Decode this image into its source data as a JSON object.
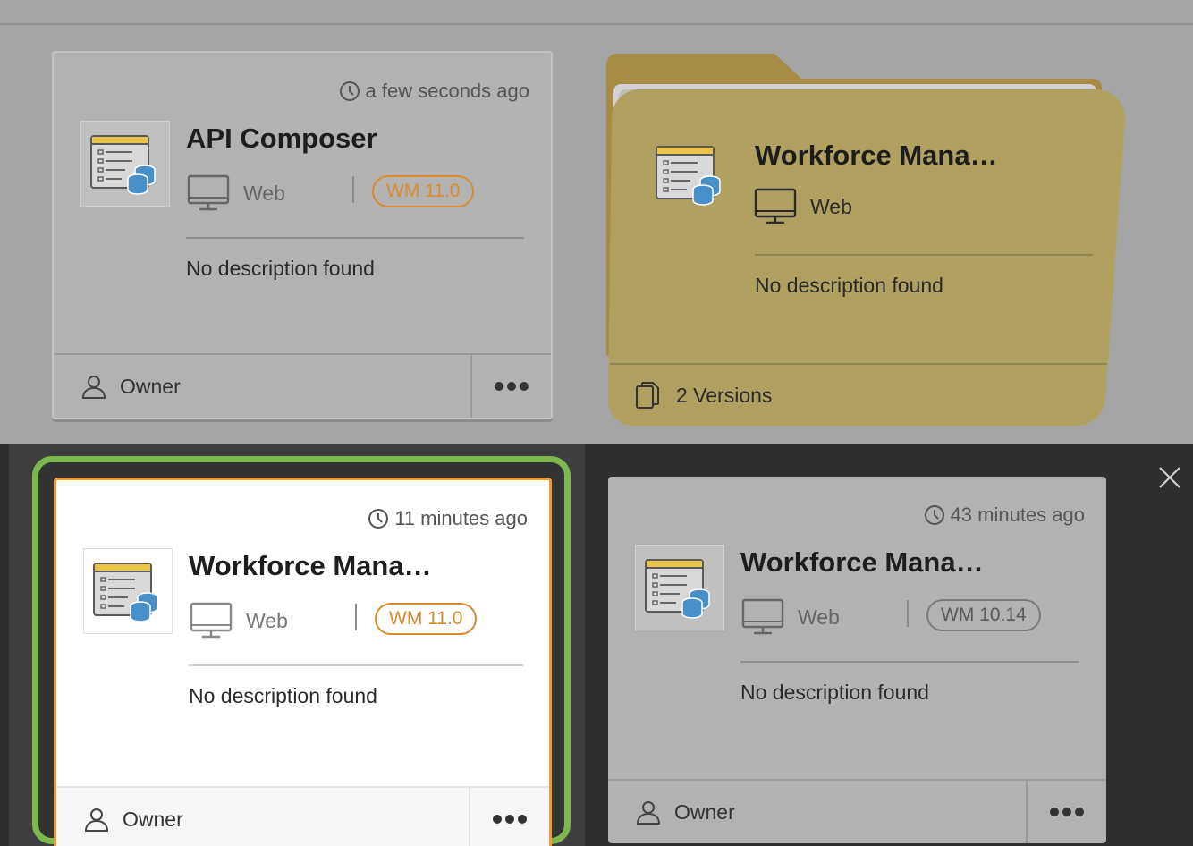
{
  "colors": {
    "accent_orange": "#f09a35",
    "selection_green": "#7fb74f",
    "folder_gold": "#b0a161"
  },
  "cards": [
    {
      "time": "a few seconds ago",
      "title": "API Composer",
      "platform": "Web",
      "version": "WM 11.0",
      "description": "No description found",
      "owner": "Owner",
      "icon": "clock-icon"
    },
    {
      "time": "11 minutes ago",
      "title": "Workforce Mana…",
      "platform": "Web",
      "version": "WM 11.0",
      "description": "No description found",
      "owner": "Owner",
      "selected": true
    },
    {
      "time": "43 minutes ago",
      "title": "Workforce Mana…",
      "platform": "Web",
      "version": "WM 10.14",
      "description": "No description found",
      "owner": "Owner"
    }
  ],
  "folder": {
    "title": "Workforce Mana…",
    "platform": "Web",
    "description": "No description found",
    "versions": "2 Versions"
  }
}
